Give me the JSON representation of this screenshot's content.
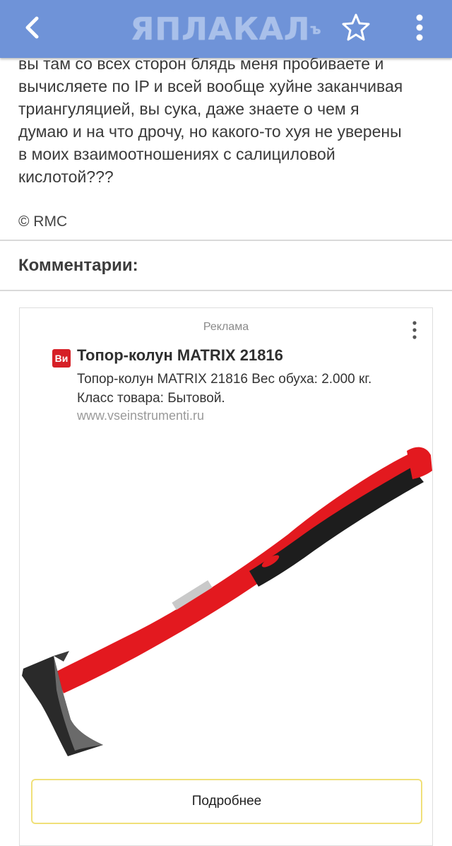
{
  "header": {
    "logo_text": "ЯПЛАКАЛ",
    "logo_suffix": "ъ",
    "background_color": "#6f93d8",
    "back_icon": "back-arrow-icon",
    "favorite_icon": "star-outline-icon",
    "menu_icon": "more-vertical-icon"
  },
  "story": {
    "text": "вы там со всех сторон блядь меня пробиваете и\nвычисляете по IP и всей вообще хуйне заканчивая\nтриангуляцией, вы сука, даже знаете о чем я\nдумаю и на что дрочу, но какого-то хуя не уверены\nв моих взаимоотношениях с салициловой\nкислотой???",
    "copyright": "© RMC"
  },
  "comments": {
    "heading": "Комментарии:"
  },
  "ad": {
    "label": "Реклама",
    "more_icon": "more-vertical-icon",
    "brand_logo_text": "Ви",
    "brand_color": "#d61f26",
    "title": "Топор-колун MATRIX 21816",
    "description": "Топор-колун MATRIX 21816 Вес обуха: 2.000 кг.\nКласс товара: Бытовой.",
    "url": "www.vseinstrumenti.ru",
    "image_icon": "axe-product-image",
    "button_label": "Подробнее",
    "button_border_color": "#f0e079"
  }
}
